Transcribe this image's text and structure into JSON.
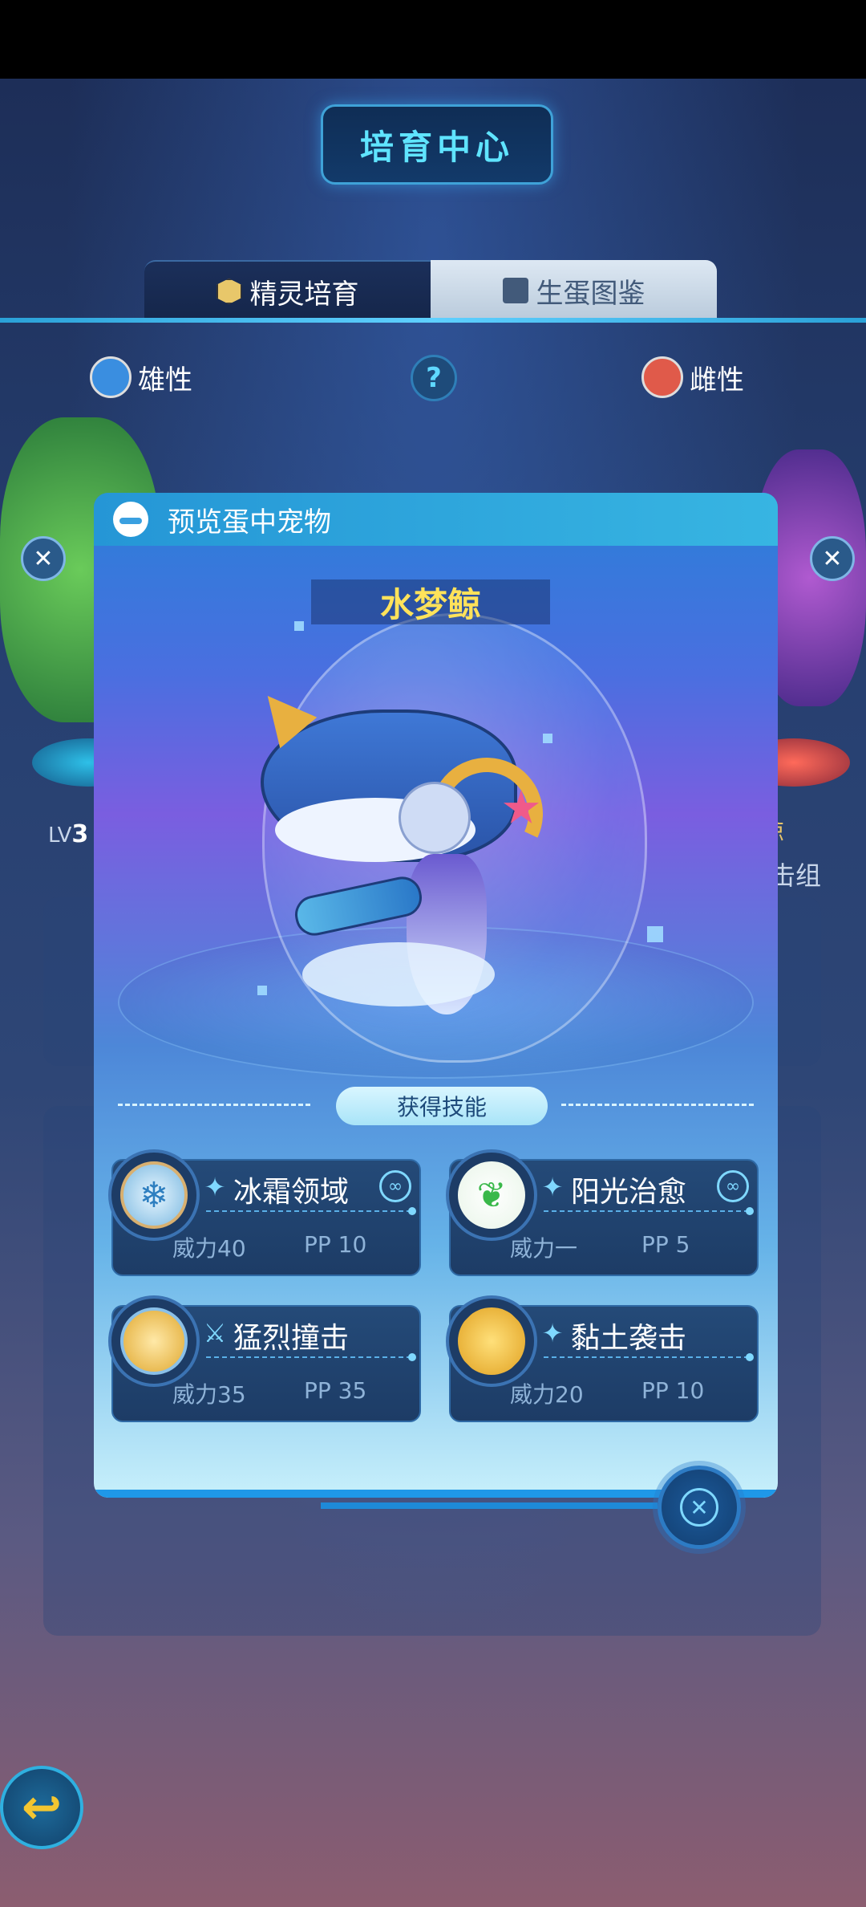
{
  "header": {
    "title": "培育中心"
  },
  "tabs": [
    {
      "label": "精灵培育",
      "icon": "hexagon-icon",
      "active": true
    },
    {
      "label": "生蛋图鉴",
      "icon": "book-icon",
      "active": false
    }
  ],
  "parents": {
    "male_label": "雄性",
    "female_label": "雌性",
    "help_symbol": "?",
    "left_level_prefix": "LV",
    "left_level": "3",
    "right_name_fragment": "鲸",
    "right_group_fragment": "击组"
  },
  "modal": {
    "title": "预览蛋中宠物",
    "pet_name": "水梦鲸",
    "skills_header": "获得技能",
    "skills": [
      {
        "name": "冰霜领域",
        "type_icon": "sparkle-icon",
        "orb_icon": "snowflake-icon",
        "power": "威力40",
        "pp": "PP 10",
        "linked": true
      },
      {
        "name": "阳光治愈",
        "type_icon": "sparkle-icon",
        "orb_icon": "leaf-icon",
        "power": "威力一",
        "pp": "PP 5",
        "linked": true
      },
      {
        "name": "猛烈撞击",
        "type_icon": "sword-icon",
        "orb_icon": "impact-icon",
        "power": "威力35",
        "pp": "PP 35",
        "linked": false
      },
      {
        "name": "黏土袭击",
        "type_icon": "sparkle-icon",
        "orb_icon": "rock-icon",
        "power": "威力20",
        "pp": "PP 10",
        "linked": false
      }
    ],
    "close_symbol": "✕"
  },
  "back_symbol": "↩",
  "colors": {
    "pet_name": "#ffe25a",
    "accent": "#5fe4ff"
  }
}
